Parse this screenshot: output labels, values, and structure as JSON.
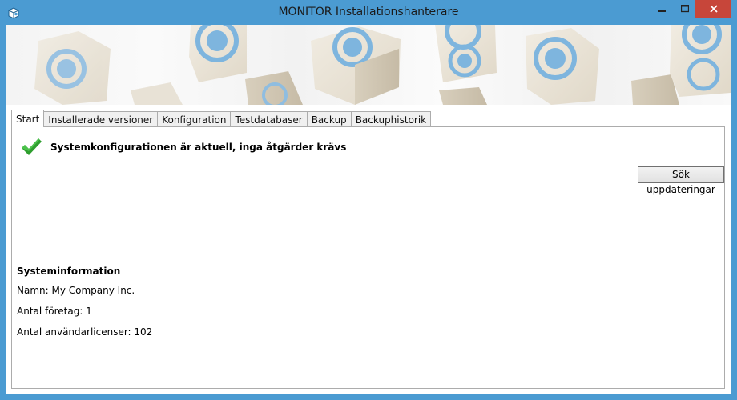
{
  "window": {
    "title": "MONITOR Installationshanterare",
    "app_icon": "package-icon",
    "controls": {
      "minimize": "minimize-icon",
      "maximize": "maximize-icon",
      "close": "close-icon"
    },
    "accent_color": "#4b9bd2",
    "close_color": "#c7463a"
  },
  "banner": {
    "decoration": "cube-logo-pattern"
  },
  "tabs": [
    {
      "label": "Start",
      "active": true
    },
    {
      "label": "Installerade versioner"
    },
    {
      "label": "Konfiguration"
    },
    {
      "label": "Testdatabaser"
    },
    {
      "label": "Backup"
    },
    {
      "label": "Backuphistorik"
    }
  ],
  "start": {
    "status_icon": "checkmark-icon",
    "status_message": "Systemkonfigurationen är aktuell, inga åtgärder krävs",
    "update_button": "Sök uppdateringar",
    "sysinfo": {
      "heading": "Systeminformation",
      "name_line": "Namn: My Company Inc.",
      "companies_line": "Antal företag: 1",
      "licenses_line": "Antal användarlicenser: 102"
    }
  }
}
